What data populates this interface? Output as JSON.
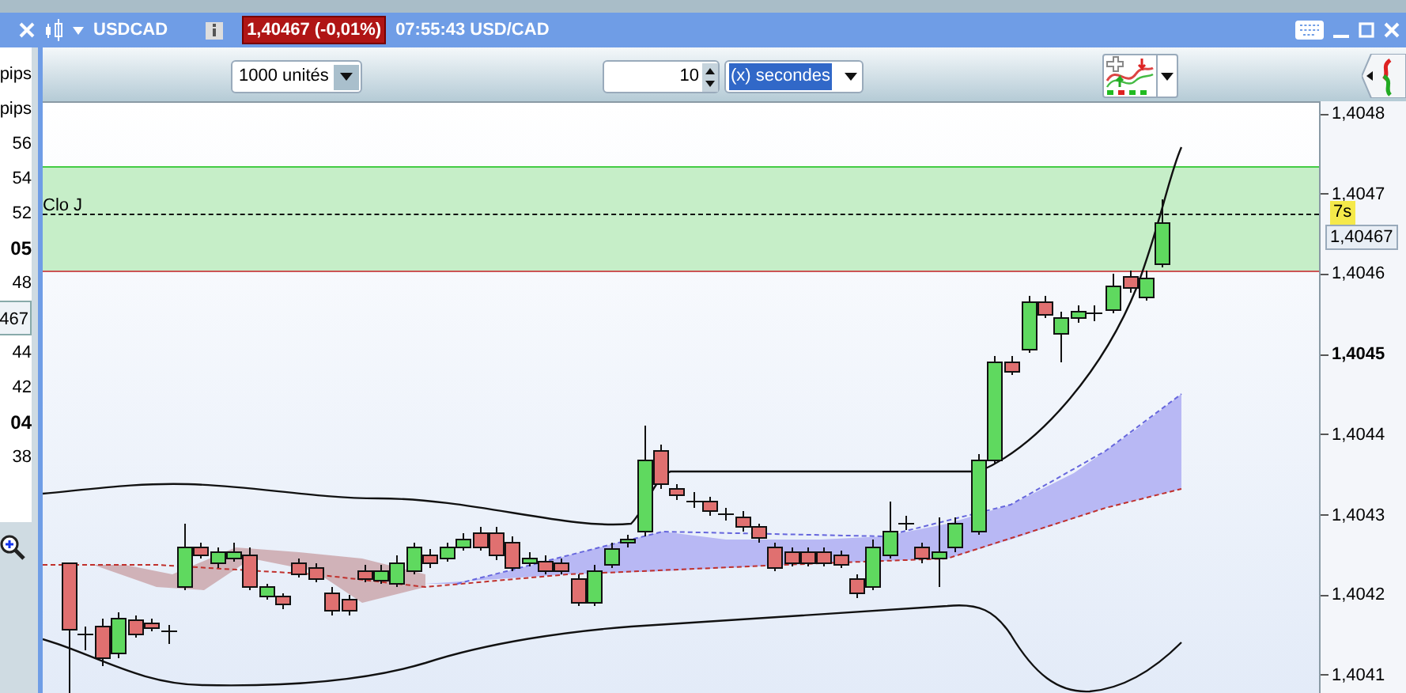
{
  "left_panel": {
    "rows": [
      {
        "text": "pips",
        "kind": "plain"
      },
      {
        "text": "pips",
        "kind": "plain"
      },
      {
        "text": "56",
        "kind": "plain"
      },
      {
        "text": "54",
        "kind": "plain"
      },
      {
        "text": "52",
        "kind": "plain"
      },
      {
        "text": "05",
        "kind": "bold"
      },
      {
        "text": "48",
        "kind": "plain"
      },
      {
        "text": "467",
        "kind": "boxed"
      },
      {
        "text": "44",
        "kind": "plain"
      },
      {
        "text": "42",
        "kind": "plain"
      },
      {
        "text": "04",
        "kind": "bold"
      },
      {
        "text": "38",
        "kind": "plain"
      }
    ]
  },
  "window": {
    "symbol": "USDCAD",
    "price_badge": "1,40467 (-0,01%)",
    "time_pair": "07:55:43 USD/CAD"
  },
  "toolbar": {
    "quantity": {
      "value": "1000 unités"
    },
    "interval": {
      "value": "10"
    },
    "unit": {
      "value": "(x) secondes",
      "selected": true
    }
  },
  "chart": {
    "zone_label": "Clo J",
    "timer": "7s",
    "price_tag": "1,40467",
    "price_axis": [
      {
        "label": "1,4048",
        "bold": false
      },
      {
        "label": "1,4047",
        "bold": false
      },
      {
        "label": "1,4046",
        "bold": false
      },
      {
        "label": "1,4045",
        "bold": true
      },
      {
        "label": "1,4044",
        "bold": false
      },
      {
        "label": "1,4043",
        "bold": false
      },
      {
        "label": "1,4042",
        "bold": false
      },
      {
        "label": "1,4041",
        "bold": false
      }
    ]
  }
}
